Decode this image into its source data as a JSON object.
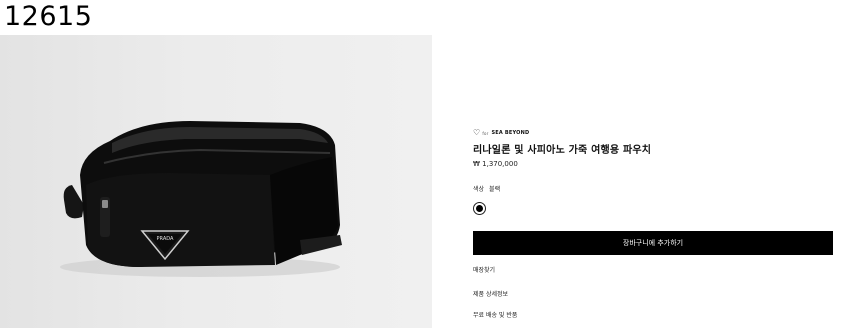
{
  "screen_id": "12615",
  "product": {
    "brand_prefix": "for",
    "brand_name": "SEA BEYOND",
    "title": "리나일론 및 사피아노 가죽 여행용 파우치",
    "price": "₩ 1,370,000",
    "color_label": "색상",
    "color_value": "블랙",
    "swatch_color": "#000000",
    "logo_text": "PRADA"
  },
  "actions": {
    "add_to_cart": "장바구니에 추가하기"
  },
  "links": {
    "find_store": "매장찾기",
    "product_details": "제품 상세정보",
    "shipping_returns": "무료 배송 및 반품"
  }
}
